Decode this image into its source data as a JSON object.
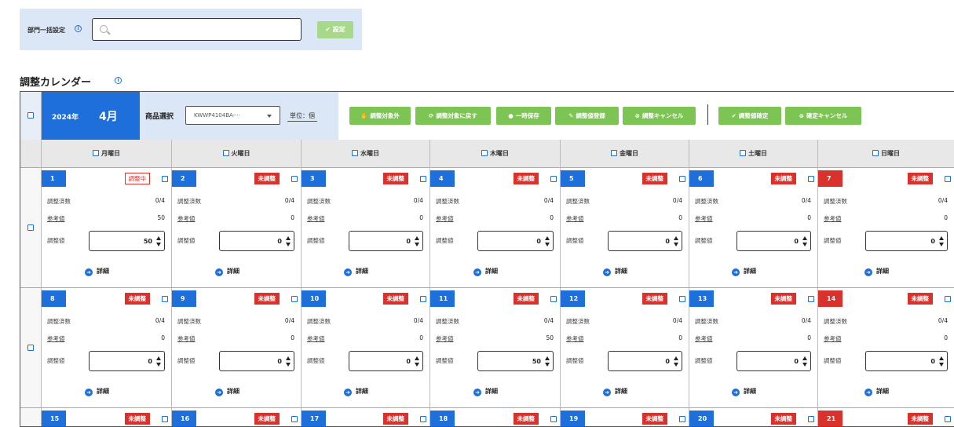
{
  "bulk": {
    "label": "部門一括設定",
    "info_icon": "info-icon",
    "search_value": "",
    "search_placeholder": "",
    "set_button": "設定"
  },
  "calendar": {
    "title": "調整カレンダー",
    "year": "2024年",
    "month": "4月",
    "product_label": "商品選択",
    "product_value": "KWWP4104BA-···",
    "unit_label": "単位：個"
  },
  "actions": [
    {
      "label": "調整対象外",
      "icon": "hand-icon"
    },
    {
      "label": "調整対象に戻す",
      "icon": "refresh-icon"
    },
    {
      "label": "一時保存",
      "icon": "save-icon"
    },
    {
      "label": "調整値登録",
      "icon": "edit-icon"
    },
    {
      "label": "調整キャンセル",
      "icon": "cancel-icon"
    },
    {
      "label": "調整値確定",
      "icon": "check-icon"
    },
    {
      "label": "確定キャンセル",
      "icon": "cancel-icon"
    }
  ],
  "weekdays": [
    "月曜日",
    "火曜日",
    "水曜日",
    "木曜日",
    "金曜日",
    "土曜日",
    "日曜日"
  ],
  "field_labels": {
    "adjusted_count": "調整済数",
    "reference": "参考値",
    "adjust_value": "調整値",
    "detail": "詳細"
  },
  "weeks": [
    {
      "days": [
        {
          "day": "1",
          "status": "調整中",
          "count": "0/4",
          "reference": "50",
          "value": "50"
        },
        {
          "day": "2",
          "status": "未調整",
          "count": "0/4",
          "reference": "0",
          "value": "0"
        },
        {
          "day": "3",
          "status": "未調整",
          "count": "0/4",
          "reference": "0",
          "value": "0"
        },
        {
          "day": "4",
          "status": "未調整",
          "count": "0/4",
          "reference": "0",
          "value": "0"
        },
        {
          "day": "5",
          "status": "未調整",
          "count": "0/4",
          "reference": "0",
          "value": "0"
        },
        {
          "day": "6",
          "status": "未調整",
          "count": "0/4",
          "reference": "0",
          "value": "0"
        },
        {
          "day": "7",
          "status": "未調整",
          "count": "0/4",
          "reference": "0",
          "value": "0"
        }
      ]
    },
    {
      "days": [
        {
          "day": "8",
          "status": "未調整",
          "count": "0/4",
          "reference": "0",
          "value": "0"
        },
        {
          "day": "9",
          "status": "未調整",
          "count": "0/4",
          "reference": "0",
          "value": "0"
        },
        {
          "day": "10",
          "status": "未調整",
          "count": "0/4",
          "reference": "0",
          "value": "0"
        },
        {
          "day": "11",
          "status": "未調整",
          "count": "0/4",
          "reference": "50",
          "value": "50"
        },
        {
          "day": "12",
          "status": "未調整",
          "count": "0/4",
          "reference": "0",
          "value": "0"
        },
        {
          "day": "13",
          "status": "未調整",
          "count": "0/4",
          "reference": "0",
          "value": "0"
        },
        {
          "day": "14",
          "status": "未調整",
          "count": "0/4",
          "reference": "0",
          "value": "0"
        }
      ]
    },
    {
      "days": [
        {
          "day": "15",
          "status": "未調整"
        },
        {
          "day": "16",
          "status": "未調整"
        },
        {
          "day": "17",
          "status": "未調整"
        },
        {
          "day": "18",
          "status": "未調整"
        },
        {
          "day": "19",
          "status": "未調整"
        },
        {
          "day": "20",
          "status": "未調整"
        },
        {
          "day": "21",
          "status": "未調整"
        }
      ]
    }
  ],
  "colors": {
    "primary": "#1e6fd9",
    "danger": "#d9312b",
    "success": "#7cc453",
    "panel": "#dbe7f7"
  }
}
